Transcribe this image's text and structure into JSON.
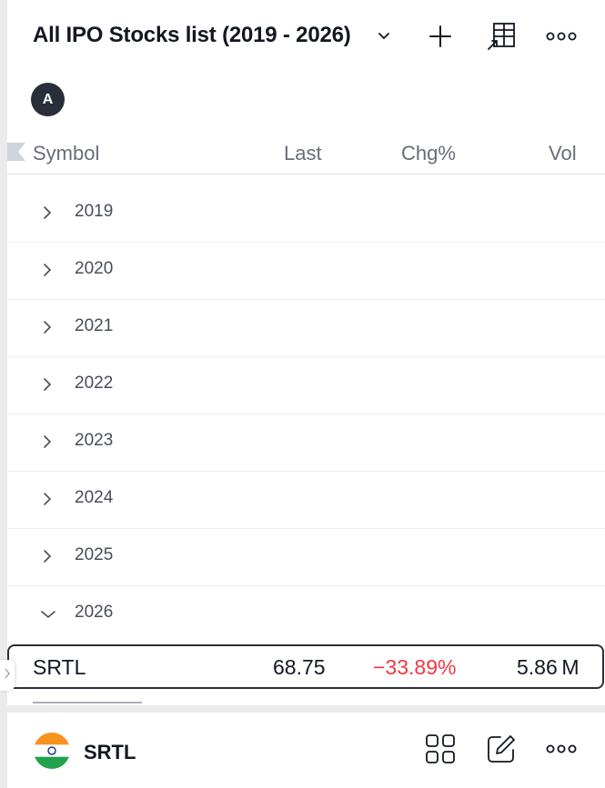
{
  "header": {
    "title": "All IPO Stocks list (2019 - 2026)",
    "add_icon": "plus-icon",
    "columns_icon": "table-layout-icon",
    "more_icon": "more-horizontal-icon"
  },
  "section": {
    "avatar_letter": "A"
  },
  "columns": {
    "symbol": "Symbol",
    "last": "Last",
    "chg": "Chg%",
    "vol": "Vol"
  },
  "groups": [
    {
      "label": "2019",
      "expanded": false
    },
    {
      "label": "2020",
      "expanded": false
    },
    {
      "label": "2021",
      "expanded": false
    },
    {
      "label": "2022",
      "expanded": false
    },
    {
      "label": "2023",
      "expanded": false
    },
    {
      "label": "2024",
      "expanded": false
    },
    {
      "label": "2025",
      "expanded": false
    },
    {
      "label": "2026",
      "expanded": true
    }
  ],
  "rows": [
    {
      "symbol": "SRTL",
      "last": "68.75",
      "chg": "−33.89%",
      "vol": "5.86 M"
    }
  ],
  "footer": {
    "symbol": "SRTL",
    "flag_icon": "india-flag-icon",
    "grid_icon": "grid-icon",
    "edit_icon": "edit-icon",
    "more_icon": "more-horizontal-icon"
  },
  "colors": {
    "negative": "#f23645",
    "text": "#131722",
    "muted": "#6a6d78"
  }
}
